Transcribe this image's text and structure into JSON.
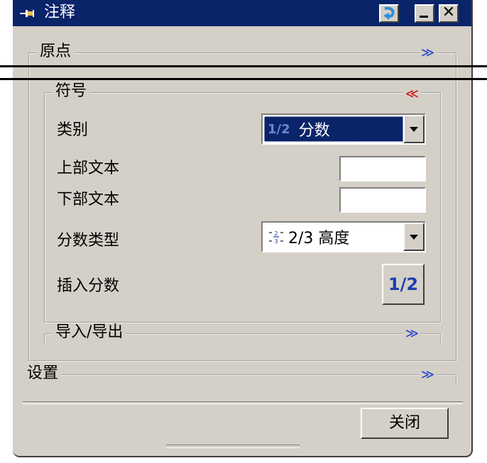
{
  "window": {
    "title": "注释"
  },
  "sections": {
    "origin": "原点",
    "symbol": "符号",
    "import_export": "导入/导出",
    "settings": "设置"
  },
  "symbol": {
    "category_label": "类别",
    "category_value": "分数",
    "category_icon_text": "1/2",
    "upper_text_label": "上部文本",
    "upper_text_value": "",
    "lower_text_label": "下部文本",
    "lower_text_value": "",
    "fraction_type_label": "分数类型",
    "fraction_type_value": "2/3 高度",
    "insert_fraction_label": "插入分数",
    "insert_fraction_button": "1/2"
  },
  "footer": {
    "close_label": "关闭"
  },
  "icons": {
    "collapse": "chevron-double-down-icon",
    "expand": "chevron-double-up-icon"
  },
  "colors": {
    "title_bar": "#0a246a",
    "selection": "#0a246a",
    "chevron_blue": "#1f3fcf",
    "chevron_red": "#cc1111"
  }
}
